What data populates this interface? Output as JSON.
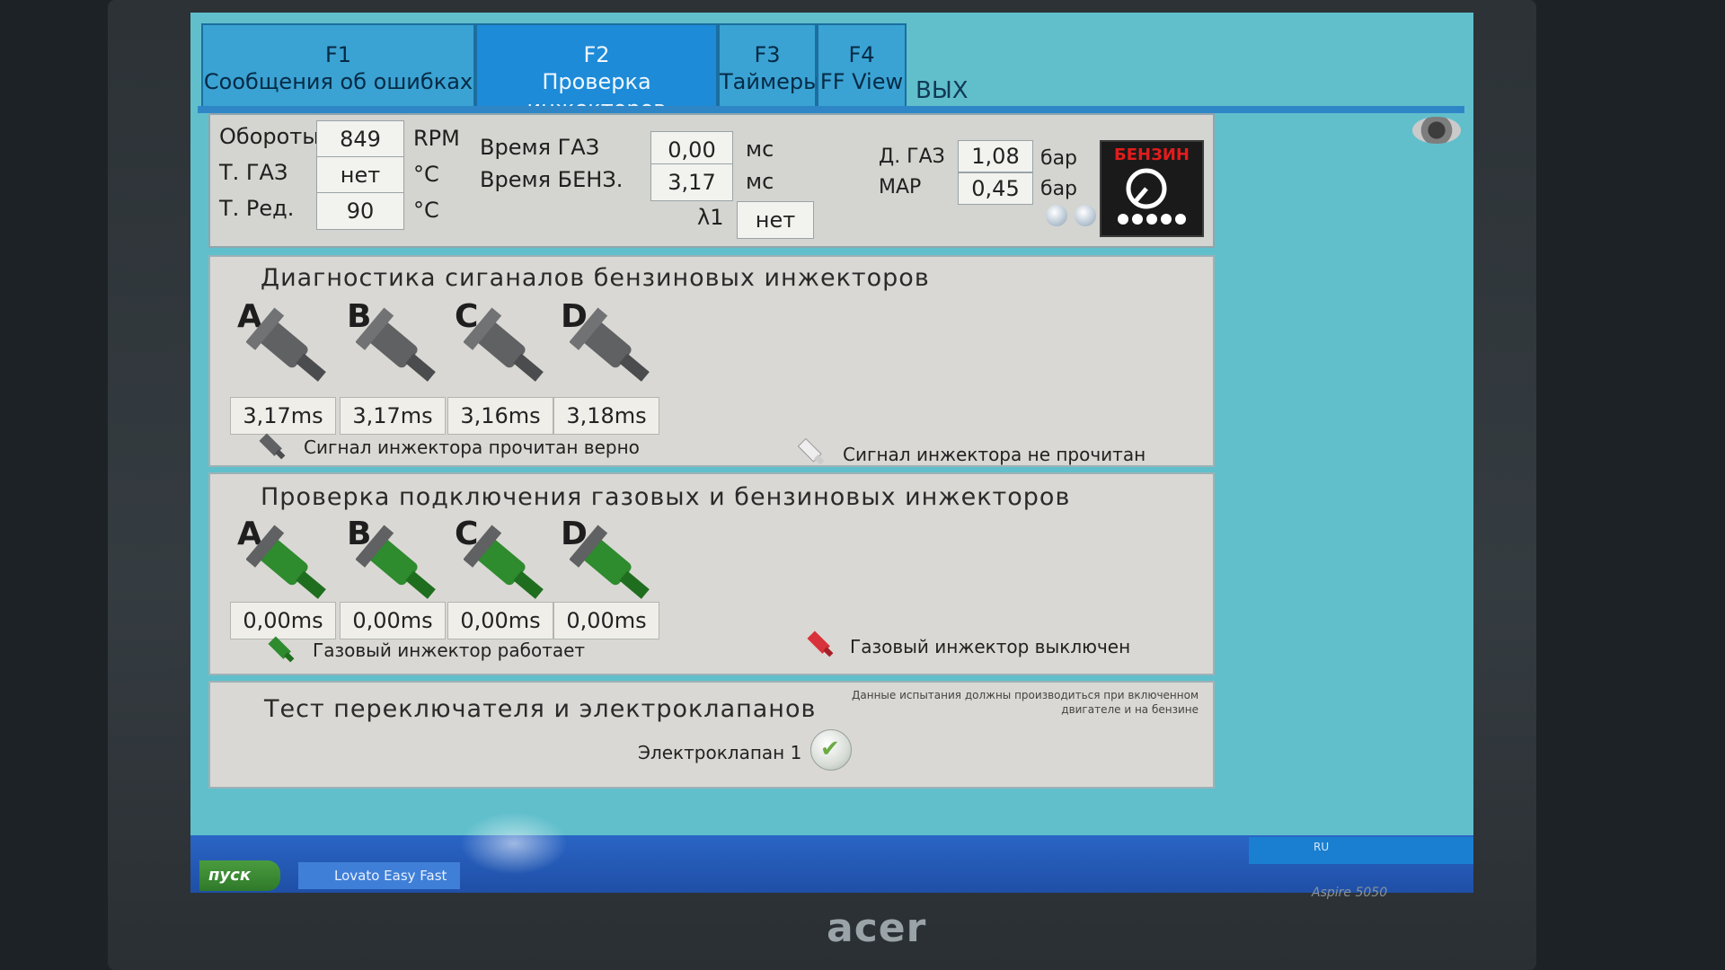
{
  "tabs": [
    {
      "key": "F1",
      "label": "Сообщения об ошибках"
    },
    {
      "key": "F2",
      "label": "Проверка инжекторов"
    },
    {
      "key": "F3",
      "label": "Таймеры"
    },
    {
      "key": "F4",
      "label": "FF View"
    }
  ],
  "exit_label": "ВЫХ",
  "status": {
    "rpm_label": "Обороты",
    "rpm_value": "849",
    "rpm_unit": "RPM",
    "tgas_label": "Т. ГАЗ",
    "tgas_value": "нет",
    "tgas_unit": "°C",
    "tred_label": "Т. Ред.",
    "tred_value": "90",
    "tred_unit": "°C",
    "time_gas_label": "Время ГАЗ",
    "time_gas_value": "0,00",
    "time_gas_unit": "мс",
    "time_benz_label": "Время БЕНЗ.",
    "time_benz_value": "3,17",
    "time_benz_unit": "мс",
    "lambda_label": "λ1",
    "lambda_value": "нет",
    "pgas_label": "Д. ГАЗ",
    "pgas_value": "1,08",
    "pgas_unit": "бар",
    "map_label": "МАР",
    "map_value": "0,45",
    "map_unit": "бар",
    "fuel_mode": "БЕНЗИН"
  },
  "petrol_section": {
    "title": "Диагностика сиганалов бензиновых инжекторов",
    "injectors": [
      {
        "letter": "A",
        "value": "3,17ms"
      },
      {
        "letter": "B",
        "value": "3,17ms"
      },
      {
        "letter": "C",
        "value": "3,16ms"
      },
      {
        "letter": "D",
        "value": "3,18ms"
      }
    ],
    "legend_ok": "Сигнал инжектора прочитан верно",
    "legend_fail": "Сигнал инжектора не прочитан"
  },
  "gas_section": {
    "title": "Проверка подключения газовых и бензиновых инжекторов",
    "injectors": [
      {
        "letter": "A",
        "value": "0,00ms"
      },
      {
        "letter": "B",
        "value": "0,00ms"
      },
      {
        "letter": "C",
        "value": "0,00ms"
      },
      {
        "letter": "D",
        "value": "0,00ms"
      }
    ],
    "legend_on": "Газовый инжектор работает",
    "legend_off": "Газовый инжектор выключен"
  },
  "switch_section": {
    "title": "Тест переключателя и электроклапанов",
    "note_line1": "Данные испытания должны производиться при включенном",
    "note_line2": "двигателе и на бензине",
    "valve_label": "Электроклапан 1"
  },
  "taskbar": {
    "start_label": "пуск",
    "task_label": "Lovato Easy Fast",
    "lang": "RU"
  },
  "laptop": {
    "brand": "acer",
    "model": "Aspire 5050"
  },
  "colors": {
    "petrol_injector": "#5f6163",
    "gas_injector": "#2e8b2e",
    "active_tab": "#1d8bd8"
  }
}
